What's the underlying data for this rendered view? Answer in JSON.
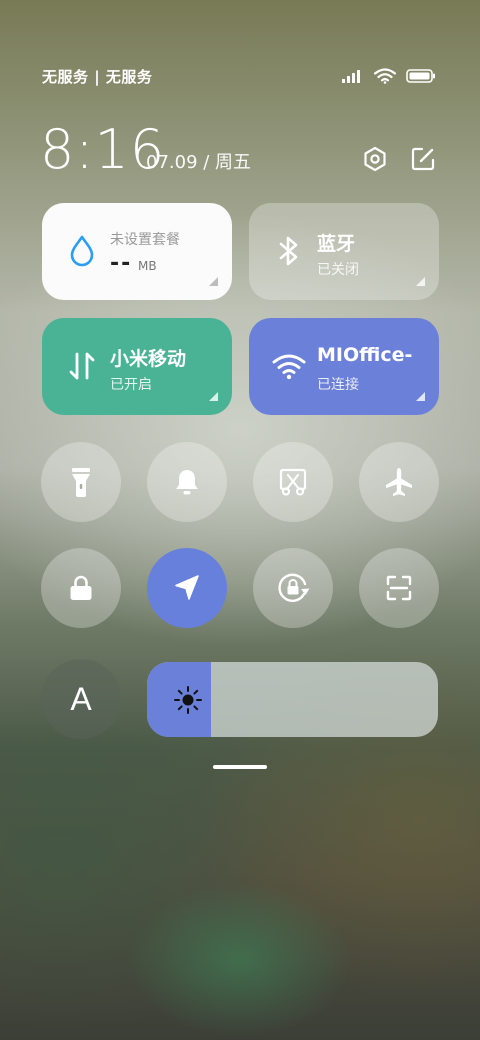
{
  "status_bar": {
    "carrier": "无服务 | 无服务"
  },
  "header": {
    "time": "8:16",
    "date": "07.09 / 周五"
  },
  "tiles": {
    "data": {
      "label": "未设置套餐",
      "value": "--",
      "unit": "MB"
    },
    "bluetooth": {
      "title": "蓝牙",
      "status": "已关闭"
    },
    "mobile": {
      "title": "小米移动",
      "status": "已开启"
    },
    "wifi": {
      "title": "MIOffice-",
      "status": "已连接"
    }
  },
  "toggles_row1": [
    "flashlight-icon",
    "bell-icon",
    "screenshot-icon",
    "airplane-icon"
  ],
  "toggles_row2": [
    "lock-icon",
    "location-icon",
    "rotation-lock-icon",
    "scan-icon"
  ],
  "font_toggle": {
    "label": "A"
  },
  "brightness": {
    "level": 0.22
  },
  "colors": {
    "accent_blue": "#6b80d9",
    "mobile_green": "#4ab295",
    "data_drop_blue": "#2a9df4"
  }
}
